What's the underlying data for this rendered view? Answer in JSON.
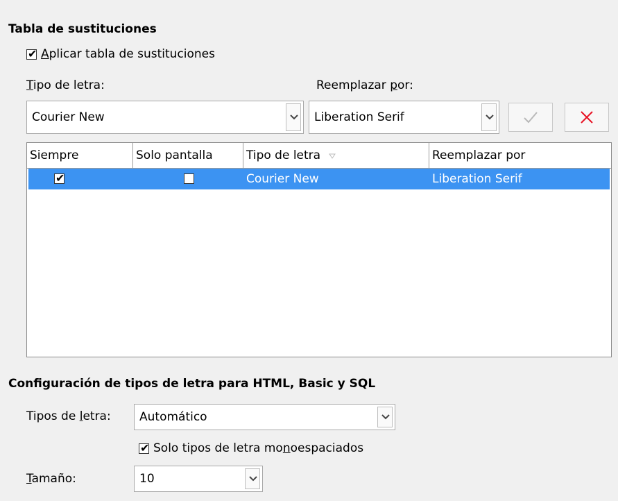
{
  "substitution": {
    "section_title": "Tabla de sustituciones",
    "apply_checkbox": {
      "mnemonic": "A",
      "rest": "plicar tabla de sustituciones",
      "checked": true
    },
    "font_label": {
      "mnemonic": "T",
      "rest": "ipo de letra:"
    },
    "replace_label": {
      "before": "Reemplazar ",
      "mnemonic": "p",
      "after": "or:"
    },
    "font_combo_value": "Courier New",
    "replace_combo_value": "Liberation Serif",
    "apply_button_icon": "checkmark-icon",
    "delete_button_icon": "close-icon",
    "table": {
      "columns": [
        "Siempre",
        "Solo pantalla",
        "Tipo de letra",
        "Reemplazar por"
      ],
      "rows": [
        {
          "always": true,
          "screen_only": false,
          "font": "Courier New",
          "replace": "Liberation Serif",
          "selected": true
        }
      ]
    }
  },
  "html_fonts": {
    "section_title": "Configuración de tipos de letra para HTML, Basic y SQL",
    "fonts_label": {
      "before": "Tipos de ",
      "mnemonic": "l",
      "after": "etra:"
    },
    "fonts_value": "Automático",
    "mono_checkbox": {
      "before": "Solo tipos de letra mo",
      "mnemonic": "n",
      "after": "oespaciados",
      "checked": true
    },
    "size_label": {
      "mnemonic": "T",
      "rest": "amaño:"
    },
    "size_value": "10"
  },
  "colors": {
    "selection": "#3c93f2",
    "delete_red": "#e81123",
    "apply_disabled": "#b9b9b9"
  }
}
